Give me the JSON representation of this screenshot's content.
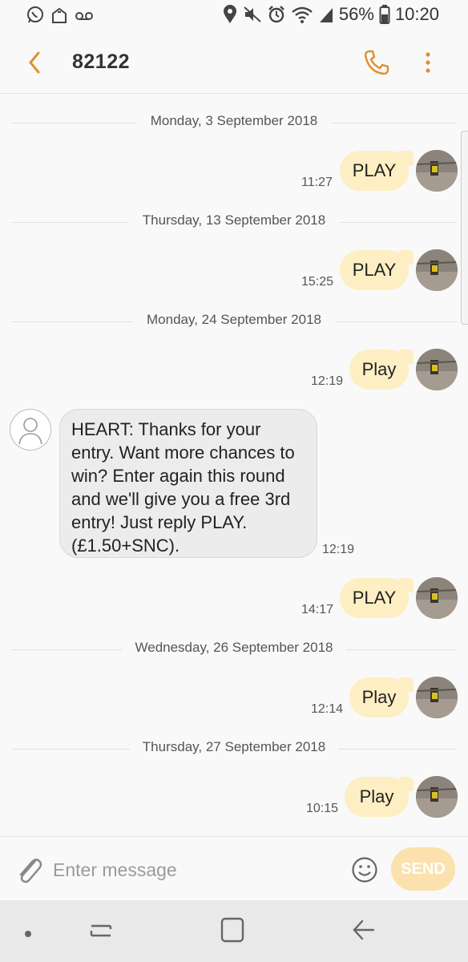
{
  "status_bar": {
    "battery": "56%",
    "time": "10:20",
    "icons": [
      "whatsapp-icon",
      "notification-icon",
      "voicemail-icon",
      "location-icon",
      "mute-icon",
      "alarm-icon",
      "wifi-icon",
      "signal-icon",
      "battery-icon"
    ]
  },
  "header": {
    "title": "82122"
  },
  "thread": {
    "dates": [
      "Monday, 3 September 2018",
      "Thursday, 13 September 2018",
      "Monday, 24 September 2018",
      "Wednesday, 26 September 2018",
      "Thursday, 27 September 2018"
    ],
    "messages": [
      {
        "dir": "out",
        "text": "PLAY",
        "time": "11:27"
      },
      {
        "dir": "out",
        "text": "PLAY",
        "time": "15:25"
      },
      {
        "dir": "out",
        "text": "Play",
        "time": "12:19"
      },
      {
        "dir": "in",
        "text": "HEART: Thanks for your entry. Want more chances to win? Enter again this round and we'll give you a free 3rd entry! Just reply PLAY. (£1.50+SNC).",
        "time": "12:19"
      },
      {
        "dir": "out",
        "text": "PLAY",
        "time": "14:17"
      },
      {
        "dir": "out",
        "text": "Play",
        "time": "12:14"
      },
      {
        "dir": "out",
        "text": "Play",
        "time": "10:15"
      }
    ]
  },
  "composer": {
    "placeholder": "Enter message",
    "send_label": "SEND"
  },
  "colors": {
    "accent": "#e0902e",
    "outgoing_bubble": "#fdefc3",
    "incoming_bubble": "#ececec",
    "send_button": "#fbe1ad"
  }
}
